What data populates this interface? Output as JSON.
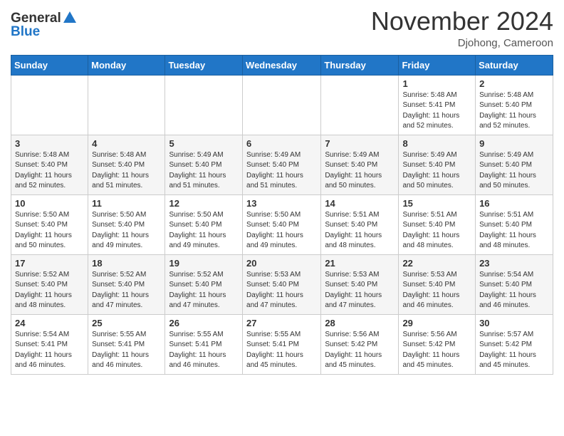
{
  "header": {
    "logo_general": "General",
    "logo_blue": "Blue",
    "month_title": "November 2024",
    "location": "Djohong, Cameroon"
  },
  "days_of_week": [
    "Sunday",
    "Monday",
    "Tuesday",
    "Wednesday",
    "Thursday",
    "Friday",
    "Saturday"
  ],
  "weeks": [
    [
      {
        "day": "",
        "sunrise": "",
        "sunset": "",
        "daylight": ""
      },
      {
        "day": "",
        "sunrise": "",
        "sunset": "",
        "daylight": ""
      },
      {
        "day": "",
        "sunrise": "",
        "sunset": "",
        "daylight": ""
      },
      {
        "day": "",
        "sunrise": "",
        "sunset": "",
        "daylight": ""
      },
      {
        "day": "",
        "sunrise": "",
        "sunset": "",
        "daylight": ""
      },
      {
        "day": "1",
        "sunrise": "Sunrise: 5:48 AM",
        "sunset": "Sunset: 5:41 PM",
        "daylight": "Daylight: 11 hours and 52 minutes."
      },
      {
        "day": "2",
        "sunrise": "Sunrise: 5:48 AM",
        "sunset": "Sunset: 5:40 PM",
        "daylight": "Daylight: 11 hours and 52 minutes."
      }
    ],
    [
      {
        "day": "3",
        "sunrise": "Sunrise: 5:48 AM",
        "sunset": "Sunset: 5:40 PM",
        "daylight": "Daylight: 11 hours and 52 minutes."
      },
      {
        "day": "4",
        "sunrise": "Sunrise: 5:48 AM",
        "sunset": "Sunset: 5:40 PM",
        "daylight": "Daylight: 11 hours and 51 minutes."
      },
      {
        "day": "5",
        "sunrise": "Sunrise: 5:49 AM",
        "sunset": "Sunset: 5:40 PM",
        "daylight": "Daylight: 11 hours and 51 minutes."
      },
      {
        "day": "6",
        "sunrise": "Sunrise: 5:49 AM",
        "sunset": "Sunset: 5:40 PM",
        "daylight": "Daylight: 11 hours and 51 minutes."
      },
      {
        "day": "7",
        "sunrise": "Sunrise: 5:49 AM",
        "sunset": "Sunset: 5:40 PM",
        "daylight": "Daylight: 11 hours and 50 minutes."
      },
      {
        "day": "8",
        "sunrise": "Sunrise: 5:49 AM",
        "sunset": "Sunset: 5:40 PM",
        "daylight": "Daylight: 11 hours and 50 minutes."
      },
      {
        "day": "9",
        "sunrise": "Sunrise: 5:49 AM",
        "sunset": "Sunset: 5:40 PM",
        "daylight": "Daylight: 11 hours and 50 minutes."
      }
    ],
    [
      {
        "day": "10",
        "sunrise": "Sunrise: 5:50 AM",
        "sunset": "Sunset: 5:40 PM",
        "daylight": "Daylight: 11 hours and 50 minutes."
      },
      {
        "day": "11",
        "sunrise": "Sunrise: 5:50 AM",
        "sunset": "Sunset: 5:40 PM",
        "daylight": "Daylight: 11 hours and 49 minutes."
      },
      {
        "day": "12",
        "sunrise": "Sunrise: 5:50 AM",
        "sunset": "Sunset: 5:40 PM",
        "daylight": "Daylight: 11 hours and 49 minutes."
      },
      {
        "day": "13",
        "sunrise": "Sunrise: 5:50 AM",
        "sunset": "Sunset: 5:40 PM",
        "daylight": "Daylight: 11 hours and 49 minutes."
      },
      {
        "day": "14",
        "sunrise": "Sunrise: 5:51 AM",
        "sunset": "Sunset: 5:40 PM",
        "daylight": "Daylight: 11 hours and 48 minutes."
      },
      {
        "day": "15",
        "sunrise": "Sunrise: 5:51 AM",
        "sunset": "Sunset: 5:40 PM",
        "daylight": "Daylight: 11 hours and 48 minutes."
      },
      {
        "day": "16",
        "sunrise": "Sunrise: 5:51 AM",
        "sunset": "Sunset: 5:40 PM",
        "daylight": "Daylight: 11 hours and 48 minutes."
      }
    ],
    [
      {
        "day": "17",
        "sunrise": "Sunrise: 5:52 AM",
        "sunset": "Sunset: 5:40 PM",
        "daylight": "Daylight: 11 hours and 48 minutes."
      },
      {
        "day": "18",
        "sunrise": "Sunrise: 5:52 AM",
        "sunset": "Sunset: 5:40 PM",
        "daylight": "Daylight: 11 hours and 47 minutes."
      },
      {
        "day": "19",
        "sunrise": "Sunrise: 5:52 AM",
        "sunset": "Sunset: 5:40 PM",
        "daylight": "Daylight: 11 hours and 47 minutes."
      },
      {
        "day": "20",
        "sunrise": "Sunrise: 5:53 AM",
        "sunset": "Sunset: 5:40 PM",
        "daylight": "Daylight: 11 hours and 47 minutes."
      },
      {
        "day": "21",
        "sunrise": "Sunrise: 5:53 AM",
        "sunset": "Sunset: 5:40 PM",
        "daylight": "Daylight: 11 hours and 47 minutes."
      },
      {
        "day": "22",
        "sunrise": "Sunrise: 5:53 AM",
        "sunset": "Sunset: 5:40 PM",
        "daylight": "Daylight: 11 hours and 46 minutes."
      },
      {
        "day": "23",
        "sunrise": "Sunrise: 5:54 AM",
        "sunset": "Sunset: 5:40 PM",
        "daylight": "Daylight: 11 hours and 46 minutes."
      }
    ],
    [
      {
        "day": "24",
        "sunrise": "Sunrise: 5:54 AM",
        "sunset": "Sunset: 5:41 PM",
        "daylight": "Daylight: 11 hours and 46 minutes."
      },
      {
        "day": "25",
        "sunrise": "Sunrise: 5:55 AM",
        "sunset": "Sunset: 5:41 PM",
        "daylight": "Daylight: 11 hours and 46 minutes."
      },
      {
        "day": "26",
        "sunrise": "Sunrise: 5:55 AM",
        "sunset": "Sunset: 5:41 PM",
        "daylight": "Daylight: 11 hours and 46 minutes."
      },
      {
        "day": "27",
        "sunrise": "Sunrise: 5:55 AM",
        "sunset": "Sunset: 5:41 PM",
        "daylight": "Daylight: 11 hours and 45 minutes."
      },
      {
        "day": "28",
        "sunrise": "Sunrise: 5:56 AM",
        "sunset": "Sunset: 5:42 PM",
        "daylight": "Daylight: 11 hours and 45 minutes."
      },
      {
        "day": "29",
        "sunrise": "Sunrise: 5:56 AM",
        "sunset": "Sunset: 5:42 PM",
        "daylight": "Daylight: 11 hours and 45 minutes."
      },
      {
        "day": "30",
        "sunrise": "Sunrise: 5:57 AM",
        "sunset": "Sunset: 5:42 PM",
        "daylight": "Daylight: 11 hours and 45 minutes."
      }
    ]
  ]
}
